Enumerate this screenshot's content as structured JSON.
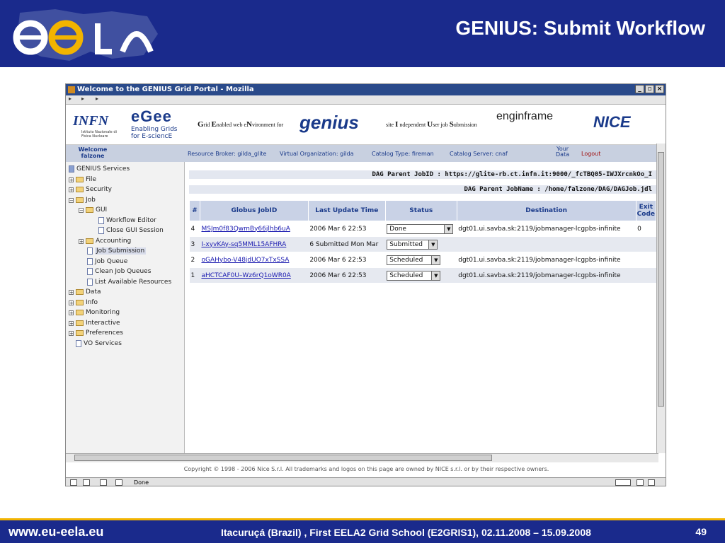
{
  "slide": {
    "title": "GENIUS: Submit Workflow",
    "footer_url": "www.eu-eela.eu",
    "footer_event": "Itacuruçá (Brazil) , First EELA2 Grid School (E2GRIS1), 02.11.2008 – 15.09.2008",
    "page_number": "49"
  },
  "browser": {
    "window_title": "Welcome to the GENIUS Grid Portal - Mozilla",
    "window_buttons": [
      "_",
      "▫",
      "×"
    ],
    "nav_buttons": [
      "▸",
      "▸",
      "▸"
    ]
  },
  "banner": {
    "infn": "INFN",
    "infn_sub": "Istituto Nazionale di Fisica Nucleare",
    "egee_logo": "eGee",
    "egee_tag1": "Enabling Grids",
    "egee_tag2": "for E-sciencE",
    "tagline_g": "G",
    "tagline_g_rest": "rid ",
    "tagline_e": "E",
    "tagline_e_rest": "nabled web e",
    "tagline_n": "N",
    "tagline_n_rest": "vironment for",
    "genius_logo": "genius",
    "site_text_1": "site ",
    "site_i": "I",
    "site_text_2": " ndependent ",
    "site_u": "U",
    "site_text_3": "ser job ",
    "site_s": "S",
    "site_text_4": "ubmission",
    "enginframe_logo": "enginframe",
    "nice_logo": "NICE"
  },
  "infobar": {
    "welcome": "Welcome",
    "user": "falzone",
    "resource_broker": "Resource Broker: gilda_glite",
    "virtual_org": "Virtual Organization: gilda",
    "catalog_type": "Catalog Type: fireman",
    "catalog_server": "Catalog Server: cnaf",
    "your_data_1": "Your",
    "your_data_2": "Data",
    "logout": "Logout"
  },
  "tree": {
    "root": "GENIUS Services",
    "file": "File",
    "security": "Security",
    "job": "Job",
    "gui": "GUI",
    "workflow_editor": "Workflow Editor",
    "close_gui_session": "Close GUI Session",
    "accounting": "Accounting",
    "job_submission": "Job Submission",
    "job_queue": "Job Queue",
    "clean_job_queues": "Clean Job Queues",
    "list_available_resources": "List Available Resources",
    "data": "Data",
    "info": "Info",
    "monitoring": "Monitoring",
    "interactive": "Interactive",
    "preferences": "Preferences",
    "vo_services": "VO Services"
  },
  "dag": {
    "parent_jobid": "DAG Parent JobID : https://glite-rb.ct.infn.it:9000/_fcTBQ05-IWJXrcnkOo_I",
    "parent_jobname": "DAG Parent JobName : /home/falzone/DAG/DAGJob.jdl"
  },
  "jobs_table": {
    "headers": {
      "num": "#",
      "jobid": "Globus JobID",
      "update": "Last Update Time",
      "status": "Status",
      "destination": "Destination",
      "exit_1": "Exit",
      "exit_2": "Code"
    },
    "rows": [
      {
        "num": "4",
        "jobid": "MSJm0f83QwmBy66jlhb6uA",
        "update": "2006 Mar 6 22:53",
        "status": "Done",
        "destination": "dgt01.ui.savba.sk:2119/jobmanager-lcgpbs-infinite",
        "exit": "0"
      },
      {
        "num": "3",
        "jobid": "I-xyvKAy-sq5MML15AFHRA",
        "update": "6 Submitted Mon Mar",
        "status": "Submitted",
        "destination": "",
        "exit": ""
      },
      {
        "num": "2",
        "jobid": "oGAHybo-V48jdUO7xTxSSA",
        "update": "2006 Mar 6 22:53",
        "status": "Scheduled",
        "destination": "dgt01.ui.savba.sk:2119/jobmanager-lcgpbs-infinite",
        "exit": ""
      },
      {
        "num": "1",
        "jobid": "aHCTCAF0U–Wz6rQ1oWR0A",
        "update": "2006 Mar 6 22:53",
        "status": "Scheduled",
        "destination": "dgt01.ui.savba.sk:2119/jobmanager-lcgpbs-infinite",
        "exit": ""
      }
    ]
  },
  "copyright": "Copyright © 1998 - 2006 Nice S.r.l. All trademarks and logos on this page are owned by NICE s.r.l. or by their respective owners.",
  "statusbar": {
    "text": "Done"
  },
  "colors": {
    "slide_blue": "#1a2a8c",
    "accent_yellow": "#f2b400",
    "link": "#1a1ab0",
    "table_header": "#c9d2e6"
  }
}
